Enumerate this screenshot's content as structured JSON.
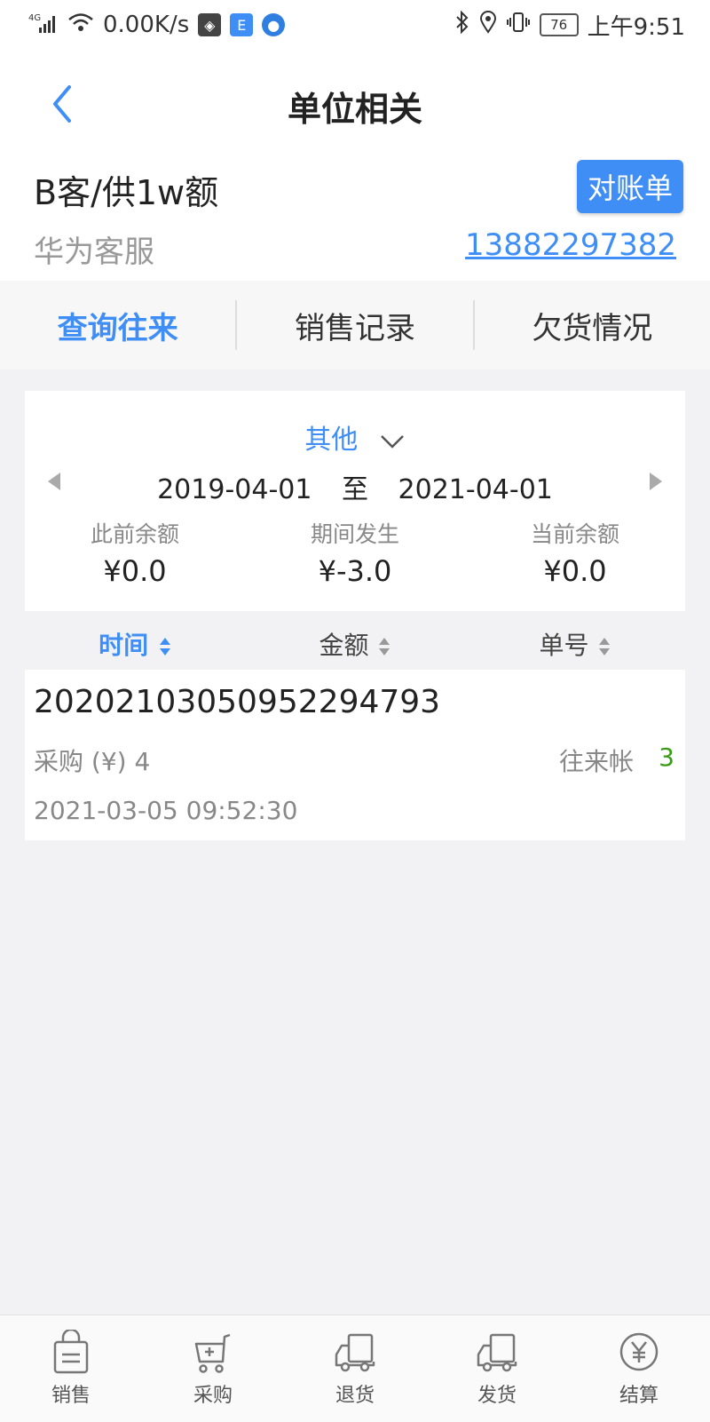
{
  "status_bar": {
    "network": "4G",
    "speed": "0.00K/s",
    "battery": "76",
    "time": "上午9:51"
  },
  "header": {
    "title": "单位相关"
  },
  "unit": {
    "name": "B客/供1w额",
    "statement_label": "对账单",
    "contact": "华为客服",
    "phone": "13882297382"
  },
  "tabs": [
    {
      "label": "查询往来",
      "active": true
    },
    {
      "label": "销售记录",
      "active": false
    },
    {
      "label": "欠货情况",
      "active": false
    }
  ],
  "filter": {
    "period": "其他",
    "start_date": "2019-04-01",
    "to_label": "至",
    "end_date": "2021-04-01"
  },
  "summary": [
    {
      "label": "此前余额",
      "value": "¥0.0"
    },
    {
      "label": "期间发生",
      "value": "¥-3.0"
    },
    {
      "label": "当前余额",
      "value": "¥0.0"
    }
  ],
  "sort": [
    {
      "label": "时间",
      "active": true
    },
    {
      "label": "金额",
      "active": false
    },
    {
      "label": "单号",
      "active": false
    }
  ],
  "records": [
    {
      "number": "20202103050952294793",
      "type": "采购 (¥) 4",
      "category": "往来帐",
      "count": "3",
      "time": "2021-03-05 09:52:30"
    }
  ],
  "bottom_nav": [
    {
      "label": "销售",
      "icon": "bag-icon"
    },
    {
      "label": "采购",
      "icon": "cart-icon"
    },
    {
      "label": "退货",
      "icon": "truck-return-icon"
    },
    {
      "label": "发货",
      "icon": "truck-icon"
    },
    {
      "label": "结算",
      "icon": "yen-icon"
    }
  ],
  "colors": {
    "accent": "#3f8ef5",
    "count_green": "#3a9b16",
    "background": "#f2f2f4"
  }
}
